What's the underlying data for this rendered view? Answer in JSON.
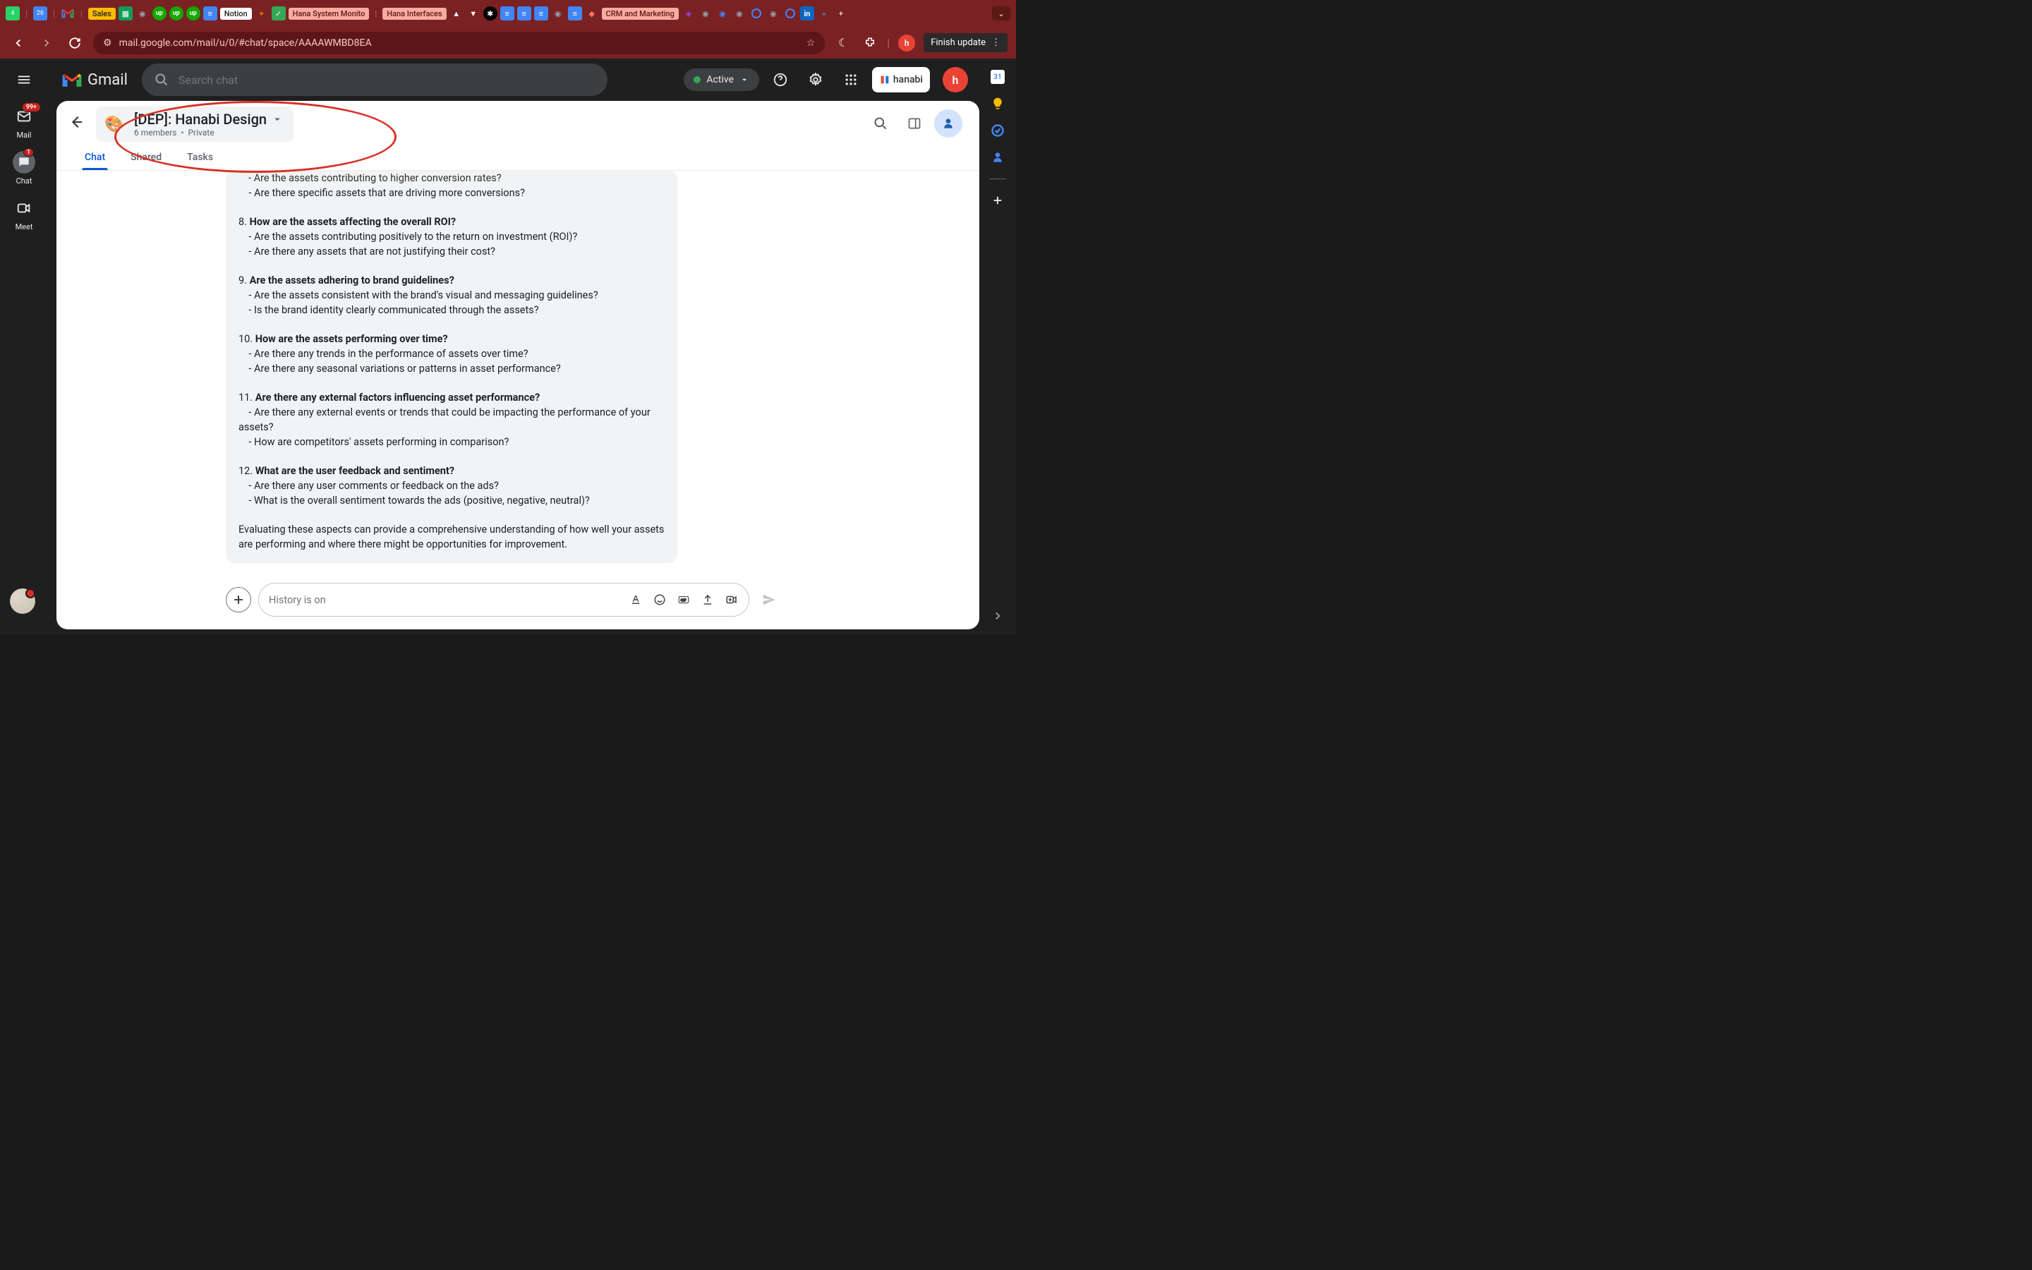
{
  "browser": {
    "tabs": {
      "sales": "Sales",
      "notion": "Notion",
      "hana_monitor": "Hana System Monito",
      "hana_interfaces": "Hana Interfaces",
      "crm": "CRM and Marketing"
    },
    "url": "mail.google.com/mail/u/0/#chat/space/AAAAWMBD8EA",
    "update_label": "Finish update"
  },
  "gmail": {
    "logo_text": "Gmail",
    "search_placeholder": "Search chat",
    "status_label": "Active"
  },
  "left_nav": {
    "mail": {
      "label": "Mail",
      "badge": "99+"
    },
    "chat": {
      "label": "Chat",
      "badge": "1"
    },
    "meet": {
      "label": "Meet"
    }
  },
  "space": {
    "name": "[DEP]: Hanabi Design",
    "members": "6 members",
    "privacy": "Private",
    "tabs": {
      "chat": "Chat",
      "shared": "Shared",
      "tasks": "Tasks"
    }
  },
  "message": {
    "l1": "- Are the assets contributing to higher conversion rates?",
    "l2": "    - Are there specific assets that are driving more conversions?",
    "q8_num": "8. ",
    "q8_title": "How are the assets affecting the overall ROI?",
    "q8_s1": "    - Are the assets contributing positively to the return on investment (ROI)?",
    "q8_s2": "    - Are there any assets that are not justifying their cost?",
    "q9_num": "9. ",
    "q9_title": "Are the assets adhering to brand guidelines?",
    "q9_s1": "    - Are the assets consistent with the brand's visual and messaging guidelines?",
    "q9_s2": "    - Is the brand identity clearly communicated through the assets?",
    "q10_num": "10. ",
    "q10_title": "How are the assets performing over time?",
    "q10_s1": "    - Are there any trends in the performance of assets over time?",
    "q10_s2": "    - Are there any seasonal variations or patterns in asset performance?",
    "q11_num": "11. ",
    "q11_title": "Are there any external factors influencing asset performance?",
    "q11_s1": "    - Are there any external events or trends that could be impacting the performance of your assets?",
    "q11_s2": "    - How are competitors' assets performing in comparison?",
    "q12_num": "12. ",
    "q12_title": "What are the user feedback and sentiment?",
    "q12_s1": "    - Are there any user comments or feedback on the ads?",
    "q12_s2": "    - What is the overall sentiment towards the ads (positive, negative, neutral)?",
    "conclusion": "Evaluating these aspects can provide a comprehensive understanding of how well your assets are performing and where there might be opportunities for improvement."
  },
  "compose": {
    "placeholder": "History is on"
  },
  "brand_pill": "hanabi"
}
